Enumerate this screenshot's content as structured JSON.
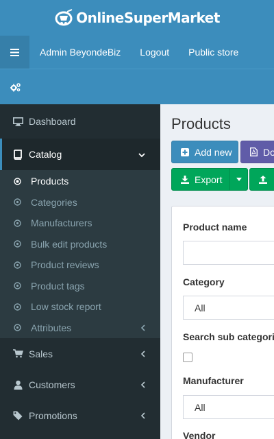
{
  "header": {
    "logo_text": "OnlineSuperMarket",
    "nav_links": [
      "Admin BeyondeBiz",
      "Logout",
      "Public store"
    ]
  },
  "sidebar": {
    "items": [
      {
        "label": "Dashboard",
        "icon": "desktop-icon"
      },
      {
        "label": "Catalog",
        "icon": "book-icon",
        "expanded": true
      },
      {
        "label": "Sales",
        "icon": "cart-icon"
      },
      {
        "label": "Customers",
        "icon": "user-icon"
      },
      {
        "label": "Promotions",
        "icon": "tag-icon"
      }
    ],
    "catalog_sub": [
      "Products",
      "Categories",
      "Manufacturers",
      "Bulk edit products",
      "Product reviews",
      "Product tags",
      "Low stock report",
      "Attributes"
    ]
  },
  "main": {
    "title": "Products",
    "buttons": {
      "add_new": "Add new",
      "pdf": "Do",
      "export": "Export"
    },
    "filters": {
      "product_name_label": "Product name",
      "product_name_value": "",
      "category_label": "Category",
      "category_value": "All",
      "search_sub_label": "Search sub categories",
      "manufacturer_label": "Manufacturer",
      "manufacturer_value": "All",
      "vendor_label": "Vendor"
    }
  },
  "colors": {
    "header": "#3c8dbc",
    "sidebar": "#222d32",
    "submenu": "#2c3b41",
    "primary": "#3c8dbc",
    "purple": "#605ca8",
    "success": "#00a65a"
  }
}
